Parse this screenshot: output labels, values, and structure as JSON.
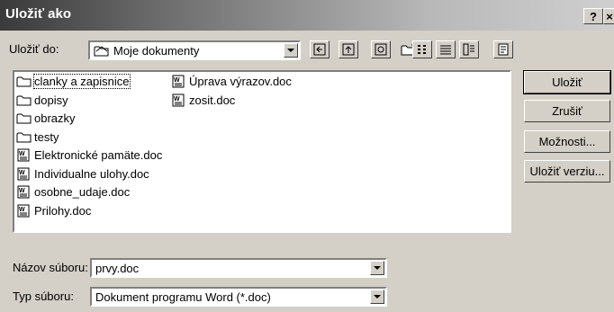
{
  "window": {
    "title": "Uložiť ako",
    "help_label": "?",
    "close_label": "×"
  },
  "save_in": {
    "label": "Uložiť do:",
    "value": "Moje dokumenty"
  },
  "toolbar": {
    "icons": [
      "back-icon",
      "up-folder-icon",
      "search-web-icon",
      "new-folder-icon",
      "list-view-icon",
      "details-view-icon",
      "properties-view-icon",
      "tools-icon"
    ]
  },
  "files": [
    {
      "name": "clanky a zapisnice",
      "type": "folder",
      "selected": true
    },
    {
      "name": "dopisy",
      "type": "folder"
    },
    {
      "name": "obrazky",
      "type": "folder"
    },
    {
      "name": "testy",
      "type": "folder"
    },
    {
      "name": "Elektronické pamäte.doc",
      "type": "doc"
    },
    {
      "name": "Individualne ulohy.doc",
      "type": "doc"
    },
    {
      "name": "osobne_udaje.doc",
      "type": "doc"
    },
    {
      "name": "Prilohy.doc",
      "type": "doc"
    },
    {
      "name": "Úprava výrazov.doc",
      "type": "doc"
    },
    {
      "name": "zosit.doc",
      "type": "doc"
    }
  ],
  "filename": {
    "label": "Názov súboru:",
    "value": "prvy.doc"
  },
  "filetype": {
    "label": "Typ súboru:",
    "value": "Dokument programu Word (*.doc)"
  },
  "buttons": {
    "save": "Uložiť",
    "cancel": "Zrušiť",
    "options": "Možnosti...",
    "save_version": "Uložiť verziu..."
  }
}
